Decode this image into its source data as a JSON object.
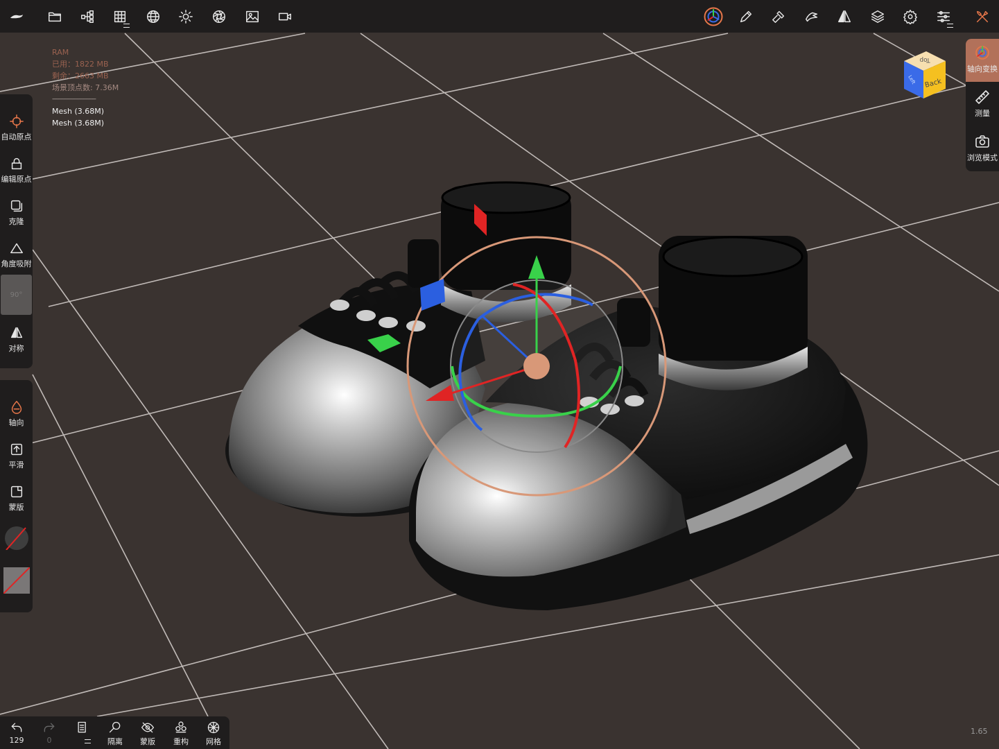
{
  "toolbar_left": [
    {
      "name": "app-logo-icon"
    },
    {
      "name": "folder-icon"
    },
    {
      "name": "scene-tree-icon"
    },
    {
      "name": "grid-icon",
      "has_submenu": true
    },
    {
      "name": "sphere-mesh-icon"
    },
    {
      "name": "sun-icon"
    },
    {
      "name": "aperture-icon"
    },
    {
      "name": "image-icon"
    },
    {
      "name": "video-camera-icon"
    }
  ],
  "toolbar_right": [
    {
      "name": "gizmo-transform-icon",
      "active": true
    },
    {
      "name": "brush-icon"
    },
    {
      "name": "hammer-icon"
    },
    {
      "name": "hand-tool-icon"
    },
    {
      "name": "symmetry-icon"
    },
    {
      "name": "layers-icon"
    },
    {
      "name": "settings-icon"
    },
    {
      "name": "sliders-icon",
      "has_submenu": true
    },
    {
      "name": "tools-icon",
      "color": "#e8774a"
    }
  ],
  "info": {
    "ram_label": "RAM",
    "used": "已用：1822 MB",
    "free": "剩余：2663 MB",
    "vertices": "场景顶点数: 7.36M",
    "separator": "----------------------------",
    "meshes": [
      "Mesh (3.68M)",
      "Mesh (3.68M)"
    ]
  },
  "left_panel_top": {
    "items": [
      {
        "id": "auto-origin",
        "label": "自动原点",
        "icon": "crosshair-icon"
      },
      {
        "id": "edit-origin",
        "label": "编辑原点",
        "icon": "lock-icon"
      },
      {
        "id": "clone",
        "label": "克隆",
        "icon": "clone-icon"
      },
      {
        "id": "angle-snap",
        "label": "角度吸附",
        "icon": "angle-icon"
      },
      {
        "id": "snap-value",
        "label": "90°",
        "icon": ""
      },
      {
        "id": "symmetry",
        "label": "对称",
        "icon": "symmetry-icon"
      }
    ]
  },
  "left_panel_bottom": {
    "items": [
      {
        "id": "axis",
        "label": "轴向",
        "icon": "drop-icon"
      },
      {
        "id": "smooth",
        "label": "平滑",
        "icon": "smooth-icon"
      },
      {
        "id": "mask",
        "label": "蒙版",
        "icon": "mask-icon"
      }
    ]
  },
  "right_panel": {
    "items": [
      {
        "id": "axis-transform",
        "label": "轴向变换",
        "icon": "axis-gizmo-icon",
        "active": true
      },
      {
        "id": "measure",
        "label": "测量",
        "icon": "ruler-icon"
      },
      {
        "id": "browse-mode",
        "label": "浏览模式",
        "icon": "camera-icon"
      }
    ]
  },
  "view_cube": {
    "top": "Top",
    "back": "Back",
    "left": "Left"
  },
  "bottom_bar": {
    "undo_count": "129",
    "redo_count": "0",
    "buttons": [
      {
        "id": "layers",
        "label": "",
        "icon": "file-list-icon"
      },
      {
        "id": "isolate",
        "label": "隔离",
        "icon": "magnifier-icon"
      },
      {
        "id": "mask",
        "label": "蒙版",
        "icon": "eye-off-icon"
      },
      {
        "id": "remesh",
        "label": "重构",
        "icon": "remesh-icon"
      },
      {
        "id": "mesh",
        "label": "网格",
        "icon": "wireframe-icon"
      }
    ]
  },
  "version": "1.65",
  "colors": {
    "background": "#3a3330",
    "panel": "#1f1d1d",
    "accent": "#e8774a",
    "gizmo_x": "#e02424",
    "gizmo_y": "#39d14a",
    "gizmo_z": "#2b5fe0",
    "gizmo_ring": "#d89878"
  }
}
